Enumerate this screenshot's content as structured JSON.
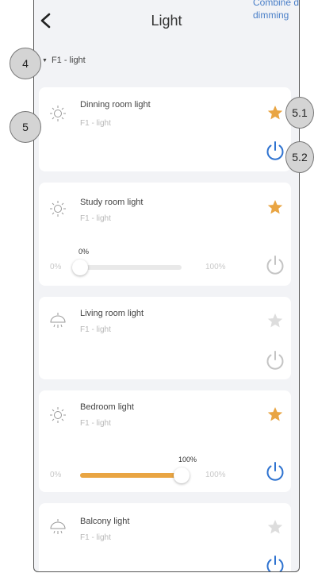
{
  "header": {
    "title": "Light",
    "combined_dimming": "Combine d dimming"
  },
  "group": {
    "label": "F1 - light"
  },
  "lights": [
    {
      "name": "Dinning room light",
      "location": "F1 - light",
      "favorite": true,
      "on": true,
      "icon": "bulb-icon"
    },
    {
      "name": "Study room light",
      "location": "F1 - light",
      "favorite": true,
      "on": false,
      "icon": "bulb-icon",
      "slider": {
        "min_label": "0%",
        "max_label": "100%",
        "value_label": "0%",
        "value": 0
      }
    },
    {
      "name": "Living room light",
      "location": "F1 - light",
      "favorite": false,
      "on": false,
      "icon": "ceiling-lamp-icon"
    },
    {
      "name": "Bedroom light",
      "location": "F1 - light",
      "favorite": true,
      "on": true,
      "icon": "bulb-icon",
      "slider": {
        "min_label": "0%",
        "max_label": "100%",
        "value_label": "100%",
        "value": 100
      }
    },
    {
      "name": "Balcony light",
      "location": "F1 - light",
      "favorite": false,
      "on": true,
      "icon": "ceiling-lamp-icon"
    }
  ],
  "callouts": {
    "c4": "4",
    "c5": "5",
    "c51": "5.1",
    "c52": "5.2"
  },
  "colors": {
    "accent_on": "#2f73d0",
    "off": "#c4c4c4",
    "star_on": "#e9a543",
    "star_off": "#dddddd",
    "slider_fill": "#e9a543"
  }
}
